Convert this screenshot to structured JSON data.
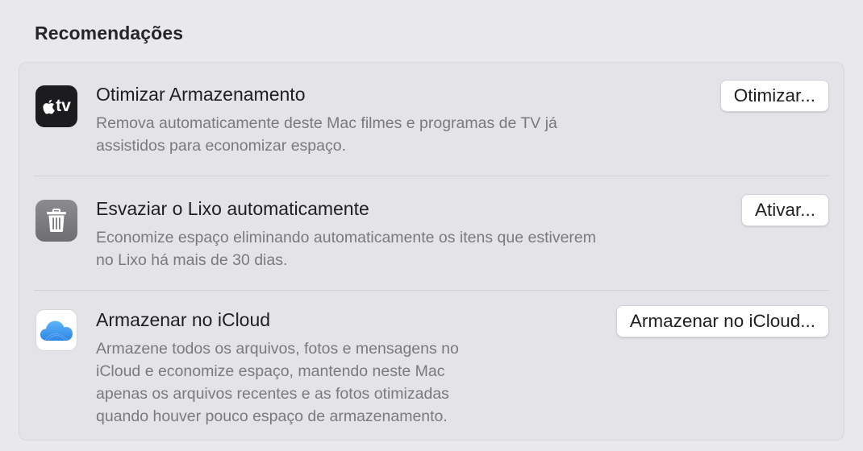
{
  "section": {
    "title": "Recomendações"
  },
  "recommendations": [
    {
      "icon": "apple-tv-icon",
      "icon_text": "tv",
      "title": "Otimizar Armazenamento",
      "description": "Remova automaticamente deste Mac filmes e programas de TV já\nassistidos para economizar espaço.",
      "button_label": "Otimizar..."
    },
    {
      "icon": "trash-icon",
      "title": "Esvaziar o Lixo automaticamente",
      "description": "Economize espaço eliminando automaticamente os itens que estiverem\nno Lixo há mais de 30 dias.",
      "button_label": "Ativar..."
    },
    {
      "icon": "icloud-icon",
      "title": "Armazenar no iCloud",
      "description": "Armazene todos os arquivos, fotos e mensagens no\niCloud e economize espaço, mantendo neste Mac\napenas os arquivos recentes e as fotos otimizadas\nquando houver pouco espaço de armazenamento.",
      "button_label": "Armazenar no iCloud..."
    }
  ],
  "colors": {
    "background": "#e9e8ec",
    "card": "#e4e3e8",
    "title_text": "#1f1f1f",
    "description_text": "#7a7a7e",
    "icloud_blue": "#3f9cf0"
  }
}
